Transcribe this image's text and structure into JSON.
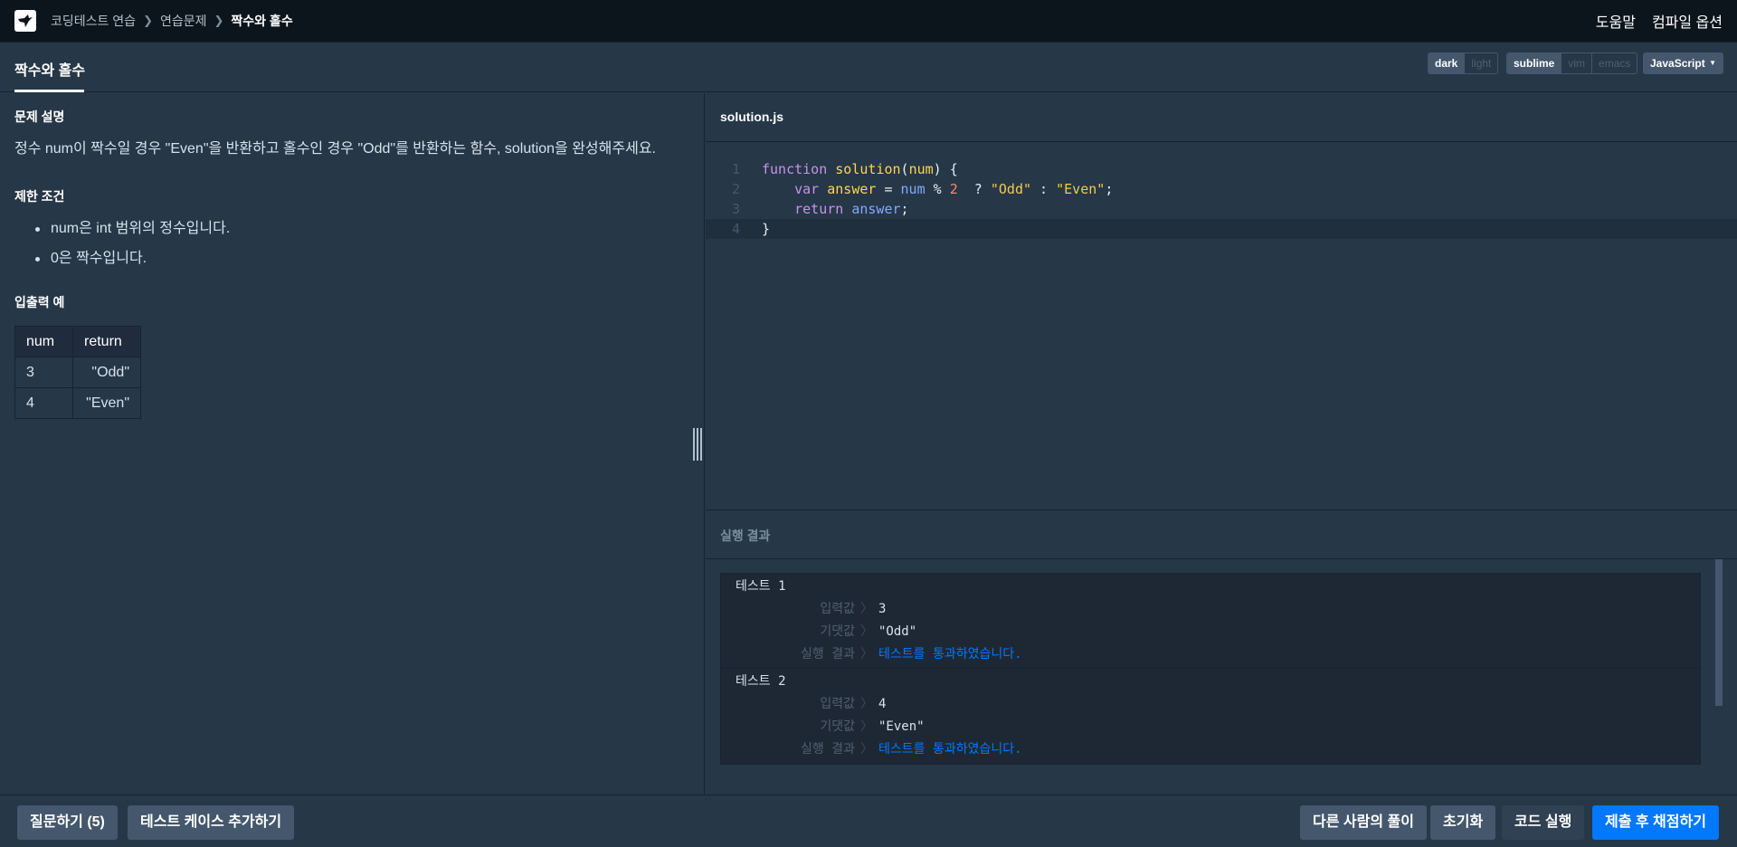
{
  "topnav": {
    "breadcrumbs": [
      "코딩테스트 연습",
      "연습문제",
      "짝수와 홀수"
    ],
    "help": "도움말",
    "compile_options": "컴파일 옵션"
  },
  "tabbar": {
    "tab": "짝수와 홀수",
    "theme": {
      "dark": "dark",
      "light": "light",
      "selected": "dark"
    },
    "keymap": {
      "sublime": "sublime",
      "vim": "vim",
      "emacs": "emacs",
      "selected": "sublime"
    },
    "language": "JavaScript"
  },
  "problem": {
    "desc_heading": "문제 설명",
    "description": "정수 num이 짝수일 경우 \"Even\"을 반환하고 홀수인 경우 \"Odd\"를 반환하는 함수, solution을 완성해주세요.",
    "constraints_heading": "제한 조건",
    "constraints": [
      "num은 int 범위의 정수입니다.",
      "0은 짝수입니다."
    ],
    "examples_heading": "입출력 예",
    "table": {
      "headers": [
        "num",
        "return"
      ],
      "rows": [
        [
          "3",
          "\"Odd\""
        ],
        [
          "4",
          "\"Even\""
        ]
      ]
    }
  },
  "editor": {
    "filename": "solution.js",
    "line_numbers": [
      "1",
      "2",
      "3",
      "4"
    ],
    "code": {
      "l1": {
        "kw": "function",
        "fn": "solution",
        "p1": "(",
        "arg": "num",
        "p2": ") {"
      },
      "l2": {
        "kw": "var",
        "name": "answer",
        "eq": " = ",
        "v": "num",
        "op": " % ",
        "num": "2",
        "q": "  ? ",
        "s1": "\"Odd\"",
        "c": " : ",
        "s2": "\"Even\"",
        "end": ";"
      },
      "l3": {
        "kw": "return",
        "v": "answer",
        "end": ";"
      },
      "l4": {
        "brace": "}"
      }
    }
  },
  "results": {
    "heading": "실행 결과",
    "tests": [
      {
        "title": "테스트 1",
        "input_label": "입력값",
        "input": "3",
        "expected_label": "기댓값",
        "expected": "\"Odd\"",
        "result_label": "실행 결과",
        "result": "테스트를 통과하였습니다."
      },
      {
        "title": "테스트 2",
        "input_label": "입력값",
        "input": "4",
        "expected_label": "기댓값",
        "expected": "\"Even\"",
        "result_label": "실행 결과",
        "result": "테스트를 통과하였습니다."
      }
    ],
    "arrow": "〉"
  },
  "bottombar": {
    "ask": "질문하기 (5)",
    "add_testcase": "테스트 케이스 추가하기",
    "others": "다른 사람의 풀이",
    "reset": "초기화",
    "run": "코드 실행",
    "submit": "제출 후 채점하기"
  },
  "colors": {
    "primary": "#0078ff",
    "background": "#263747",
    "navbar": "#0c151c"
  }
}
